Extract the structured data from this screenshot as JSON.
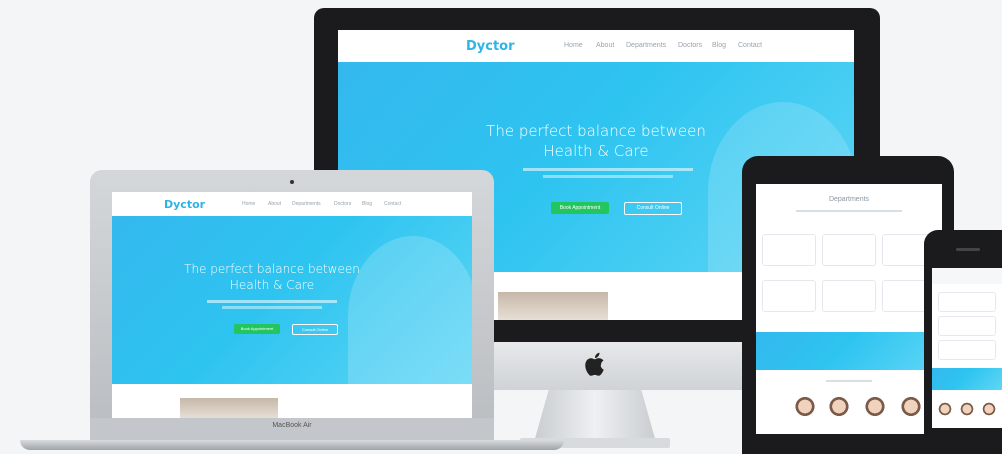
{
  "site": {
    "logo": "Dyctor",
    "hero_line1": "The perfect balance between",
    "hero_line2": "Health & Care",
    "primary_button": "Book Appointment",
    "secondary_button": "Consult Online",
    "nav": [
      "Home",
      "About",
      "Departments",
      "Doctors",
      "Blog",
      "Contact"
    ]
  },
  "laptop": {
    "label": "MacBook Air"
  },
  "tablet": {
    "section_title": "Departments"
  },
  "colors": {
    "brand": "#2fb4e8",
    "cta": "#22c55e",
    "hero_start": "#34b8ee",
    "hero_end": "#5fd6f5"
  },
  "icons": {
    "monitor_brand": "apple-logo-icon"
  }
}
